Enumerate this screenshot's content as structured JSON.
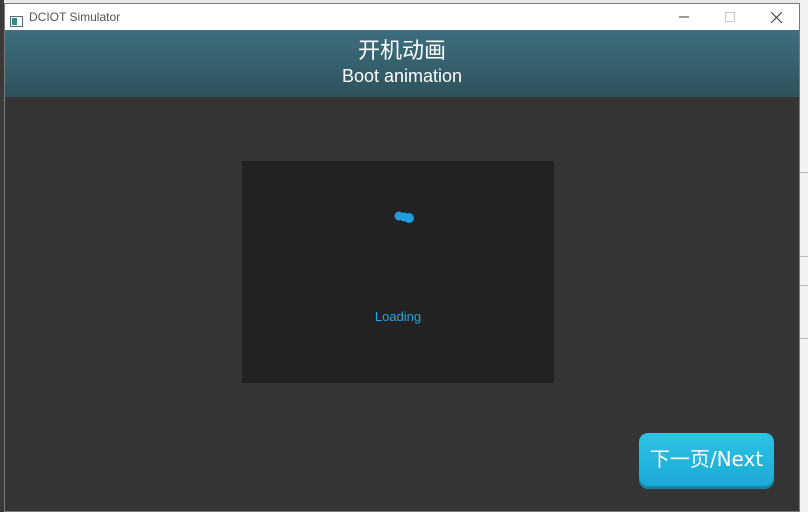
{
  "window": {
    "title": "DCIOT Simulator"
  },
  "header": {
    "title": "开机动画",
    "subtitle": "Boot animation"
  },
  "display": {
    "loading_text": "Loading"
  },
  "next_button": {
    "label": "下一页/Next"
  },
  "colors": {
    "header_top": "#3d6f7f",
    "header_bottom": "#2f525c",
    "body_bg": "#353535",
    "display_bg": "#222222",
    "accent_blue": "#20a6e6",
    "button_bg": "#2ec4e4"
  },
  "icons": [
    "app-icon",
    "minimize-icon",
    "maximize-icon",
    "close-icon",
    "spinner-icon"
  ]
}
